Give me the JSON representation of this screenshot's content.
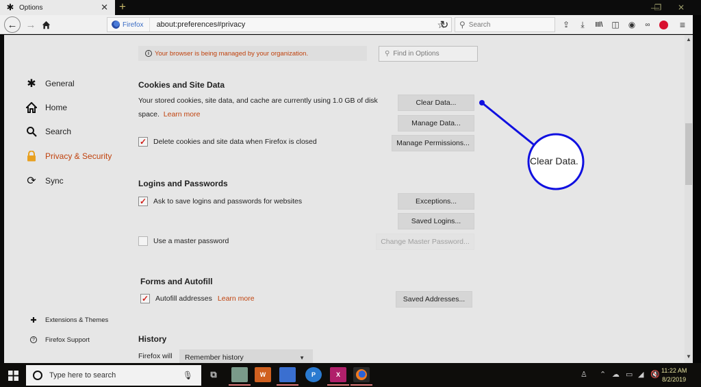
{
  "window": {
    "tab_title": "Options",
    "tab_icon": "gear-icon",
    "new_tab_label": "+",
    "controls": {
      "minimize": "—",
      "restore": "❐",
      "close": "✕"
    }
  },
  "navbar": {
    "identity_label": "Firefox",
    "url": "about:preferences#privacy",
    "search_placeholder": "Search"
  },
  "policy_notice": {
    "message": "Your browser is being managed by your organization."
  },
  "find": {
    "placeholder": "Find in Options"
  },
  "sidebar": {
    "items": [
      {
        "label": "General",
        "icon": "gear-icon",
        "active": false
      },
      {
        "label": "Home",
        "icon": "home-icon",
        "active": false
      },
      {
        "label": "Search",
        "icon": "search-icon",
        "active": false
      },
      {
        "label": "Privacy & Security",
        "icon": "lock-icon",
        "active": true
      },
      {
        "label": "Sync",
        "icon": "sync-icon",
        "active": false
      }
    ],
    "footer": [
      {
        "label": "Extensions & Themes",
        "icon": "puzzle-icon"
      },
      {
        "label": "Firefox Support",
        "icon": "help-icon"
      }
    ]
  },
  "cookies": {
    "heading": "Cookies and Site Data",
    "description_line1": "Your stored cookies, site data, and cache are currently using 1.0 GB of disk",
    "description_line2": "space.",
    "learn_more": "Learn more",
    "delete_on_close": {
      "label": "Delete cookies and site data when Firefox is closed",
      "checked": true
    },
    "buttons": {
      "clear_data": "Clear Data...",
      "manage_data": "Manage Data...",
      "manage_permissions": "Manage Permissions..."
    }
  },
  "logins": {
    "heading": "Logins and Passwords",
    "ask_to_save": {
      "label": "Ask to save logins and passwords for websites",
      "checked": true
    },
    "master_password": {
      "label": "Use a master password",
      "checked": false
    },
    "buttons": {
      "exceptions": "Exceptions...",
      "saved_logins": "Saved Logins...",
      "change_master": "Change Master Password..."
    }
  },
  "forms": {
    "heading": "Forms and Autofill",
    "autofill": {
      "label": "Autofill addresses",
      "checked": true
    },
    "learn_more": "Learn more",
    "saved_addresses": "Saved Addresses..."
  },
  "history": {
    "heading": "History",
    "firefox_will_label": "Firefox will",
    "selected_option": "Remember history"
  },
  "annotation": {
    "callout_text": "Clear Data.",
    "color": "#1010e0"
  },
  "taskbar": {
    "search_placeholder": "Type here to search",
    "time": "11:22 AM",
    "date": "8/2/2019"
  },
  "colors": {
    "accent": "#c0420d",
    "checkmark": "#d0201a"
  }
}
